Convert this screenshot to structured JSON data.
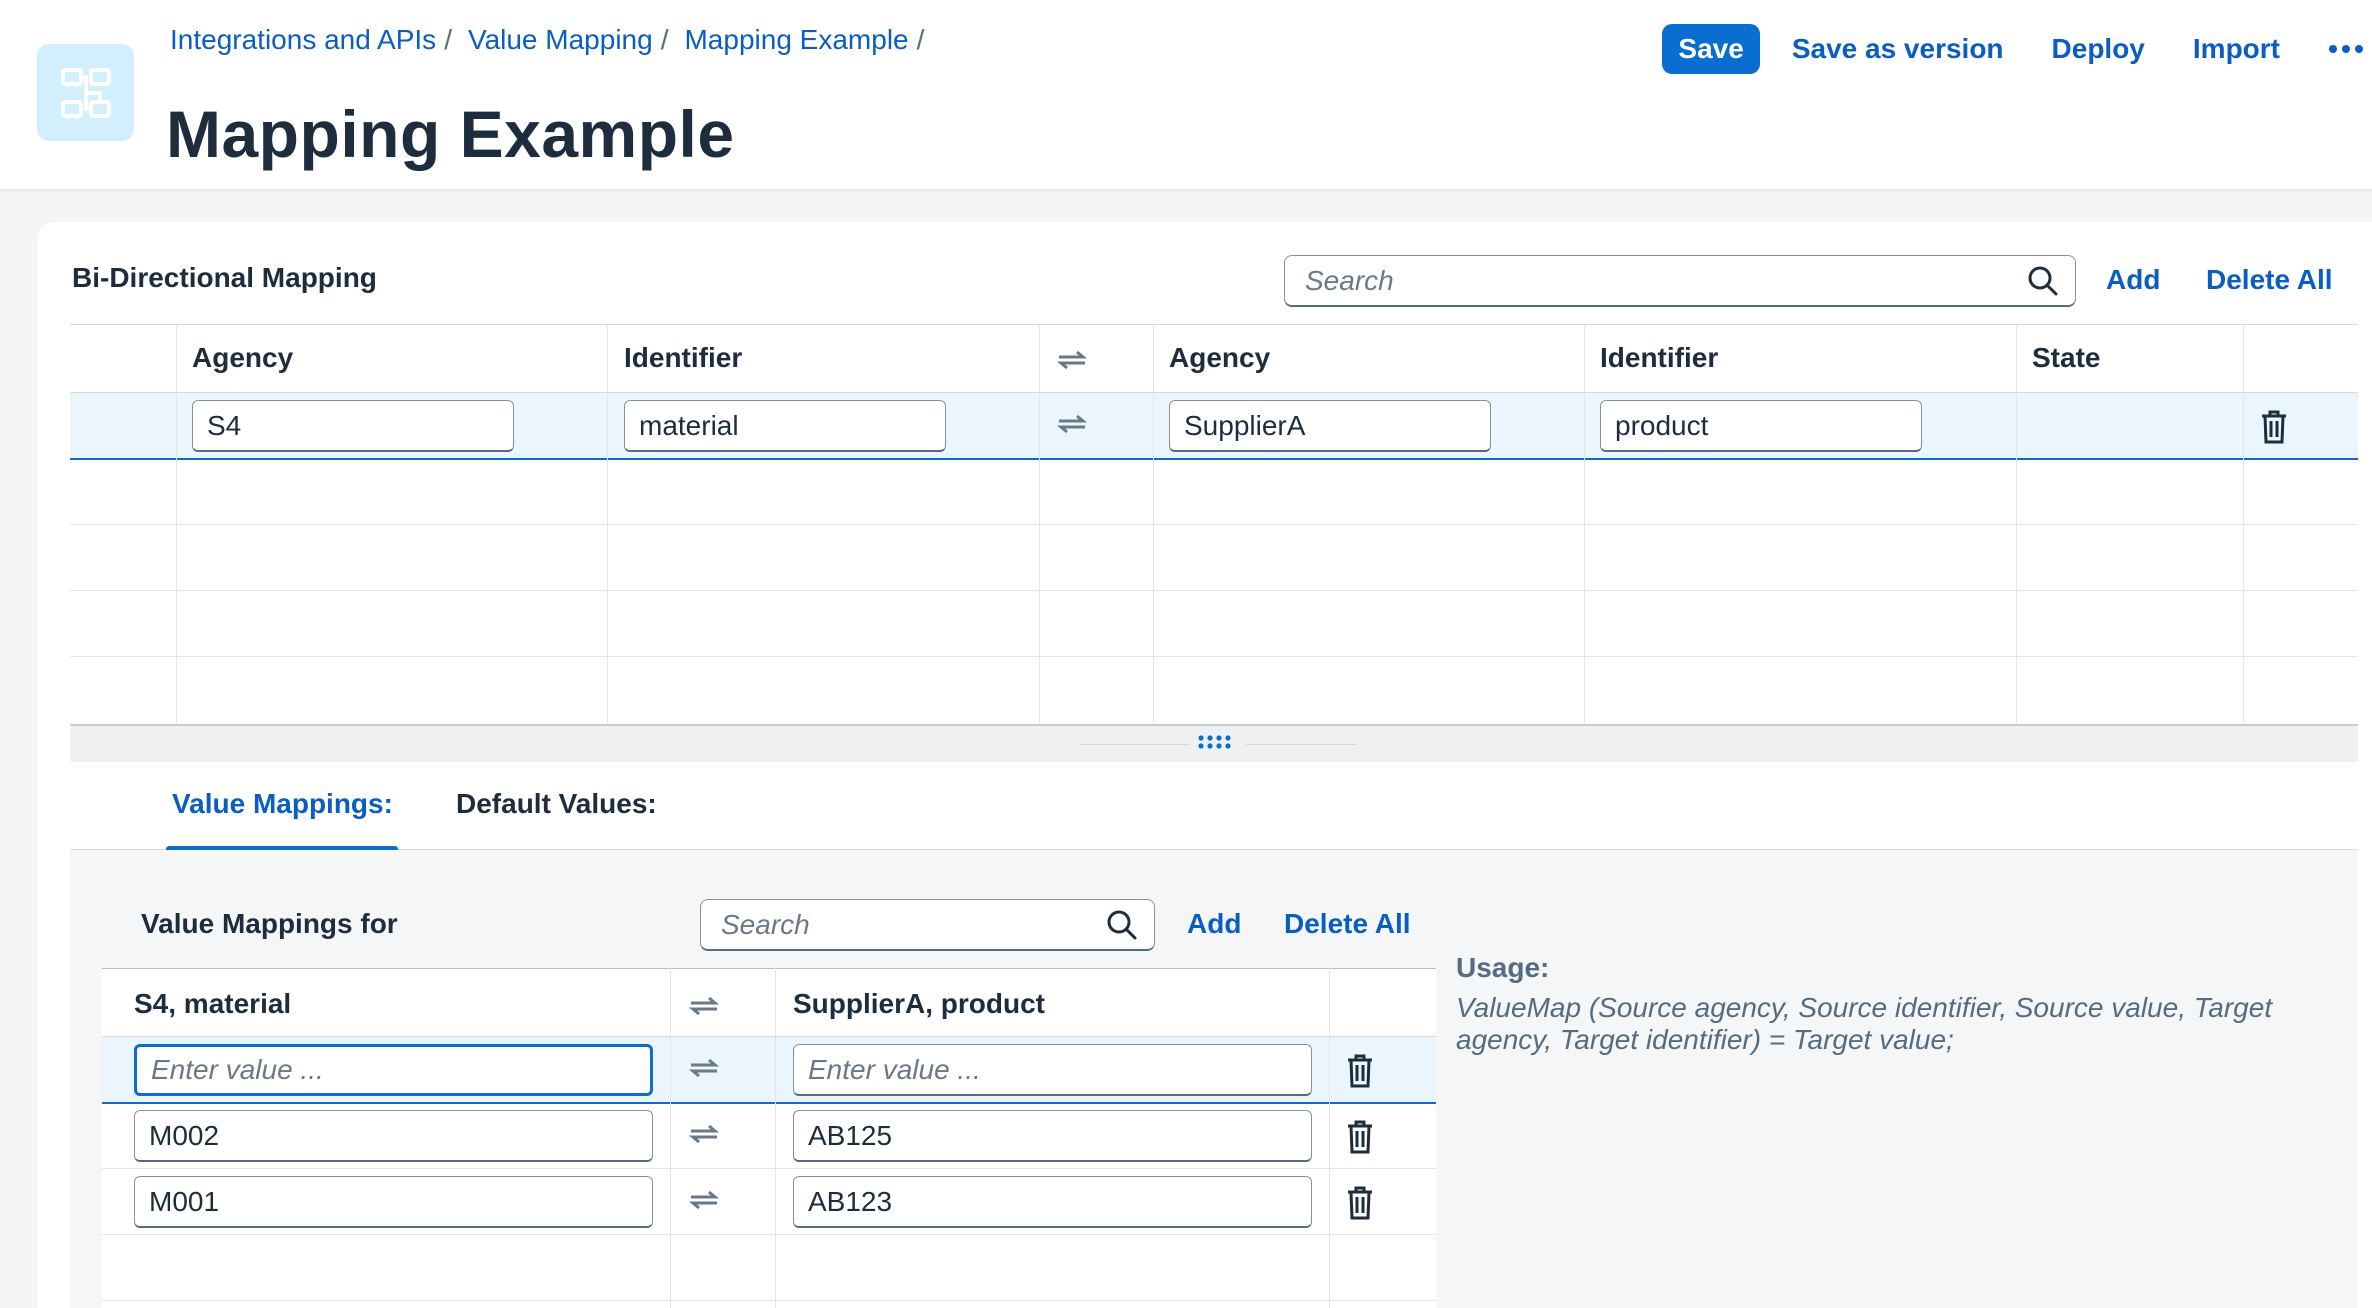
{
  "header": {
    "breadcrumb": [
      "Integrations and APIs",
      "Value Mapping",
      "Mapping Example"
    ],
    "breadcrumb_separator": "/",
    "title": "Mapping Example",
    "actions": {
      "save": "Save",
      "save_as_version": "Save as version",
      "deploy": "Deploy",
      "import": "Import",
      "more_icon": "more-horizontal-icon"
    }
  },
  "bidirectional": {
    "title": "Bi-Directional Mapping",
    "search_placeholder": "Search",
    "add": "Add",
    "delete_all": "Delete All",
    "columns": {
      "agency_1": "Agency",
      "identifier_1": "Identifier",
      "agency_2": "Agency",
      "identifier_2": "Identifier",
      "state": "State"
    },
    "rows": [
      {
        "agency_1": "S4",
        "identifier_1": "material",
        "agency_2": "SupplierA",
        "identifier_2": "product",
        "state": ""
      }
    ]
  },
  "tabs": {
    "value_mappings": "Value Mappings:",
    "default_values": "Default Values:"
  },
  "value_mappings": {
    "title": "Value Mappings for",
    "search_placeholder": "Search",
    "add": "Add",
    "delete_all": "Delete All",
    "columns": {
      "source": "S4, material",
      "target": "SupplierA, product"
    },
    "new_row_placeholder": "Enter value ...",
    "rows": [
      {
        "source": "M002",
        "target": "AB125"
      },
      {
        "source": "M001",
        "target": "AB123"
      }
    ]
  },
  "usage": {
    "label": "Usage:",
    "text": "ValueMap (Source agency, Source identifier, Source value, Target agency, Target identifier) = Target value;"
  },
  "colors": {
    "accent": "#0a6ed1",
    "link": "#0a5dc2",
    "text": "#1d2d3e",
    "selected_row": "#ebf5fe"
  }
}
